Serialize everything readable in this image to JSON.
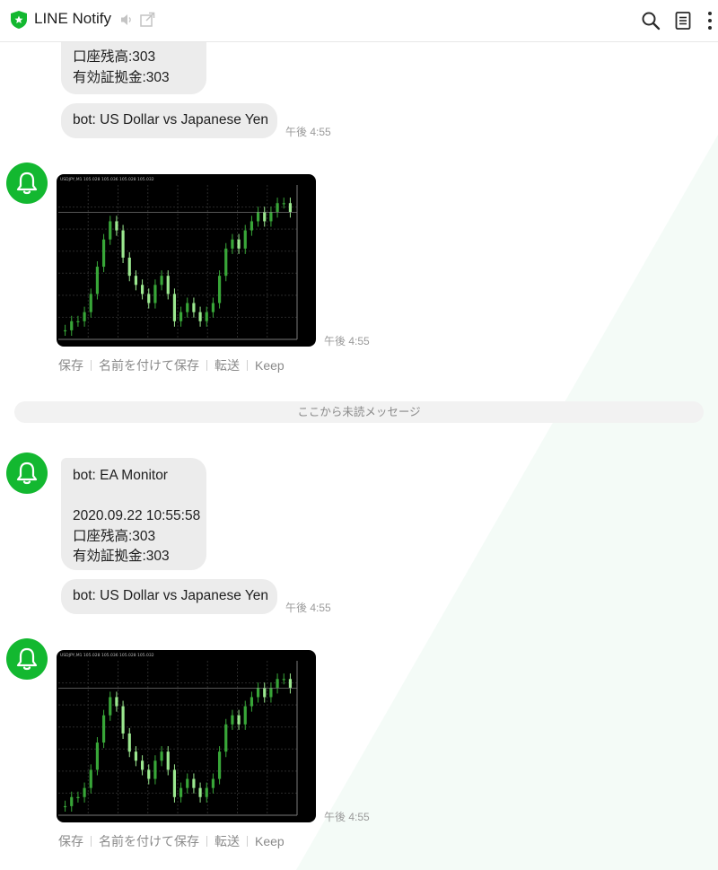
{
  "header": {
    "title": "LINE Notify",
    "icons": [
      "shield-icon",
      "speaker-mute-icon",
      "popout-icon",
      "search-icon",
      "notes-icon",
      "more-icon"
    ]
  },
  "messages": {
    "m1": {
      "lines": [
        "口座残高:303",
        "有効証拠金:303"
      ]
    },
    "m2": {
      "text": "bot:  US Dollar vs Japanese Yen",
      "time": "午後 4:55"
    },
    "m3": {
      "time": "午後 4:55"
    },
    "m4": {
      "lines": [
        "bot: EA Monitor",
        "",
        "2020.09.22 10:55:58",
        "口座残高:303",
        "有効証拠金:303"
      ]
    },
    "m5": {
      "text": "bot:  US Dollar vs Japanese Yen",
      "time": "午後 4:55"
    },
    "m6": {
      "time": "午後 4:55"
    }
  },
  "image_actions": {
    "save": "保存",
    "save_as": "名前を付けて保存",
    "forward": "転送",
    "keep": "Keep"
  },
  "unread_divider": "ここから未読メッセージ",
  "chart_header_text": "USDJPY,M1  105.028 105.036 105.028 105.032",
  "chart_data": {
    "type": "candlestick",
    "series": [
      {
        "name": "",
        "values": [
          104.94,
          104.95,
          104.95,
          104.96,
          104.98,
          105.01,
          105.04,
          105.06,
          105.05,
          105.02,
          105.0,
          104.99,
          104.98,
          104.97,
          104.99,
          105.0,
          104.98,
          104.95,
          104.96,
          104.97,
          104.96,
          104.95,
          104.96,
          104.97,
          105.0,
          105.03,
          105.04,
          105.03,
          105.05,
          105.06,
          105.07,
          105.06,
          105.07,
          105.08,
          105.08,
          105.07
        ]
      }
    ],
    "ylim": [
      104.93,
      105.1
    ],
    "color_up": "#38a638",
    "color_down": "#9be88f",
    "background": "#000000"
  },
  "colors": {
    "accent": "#13b830",
    "bubble": "#ececec"
  }
}
